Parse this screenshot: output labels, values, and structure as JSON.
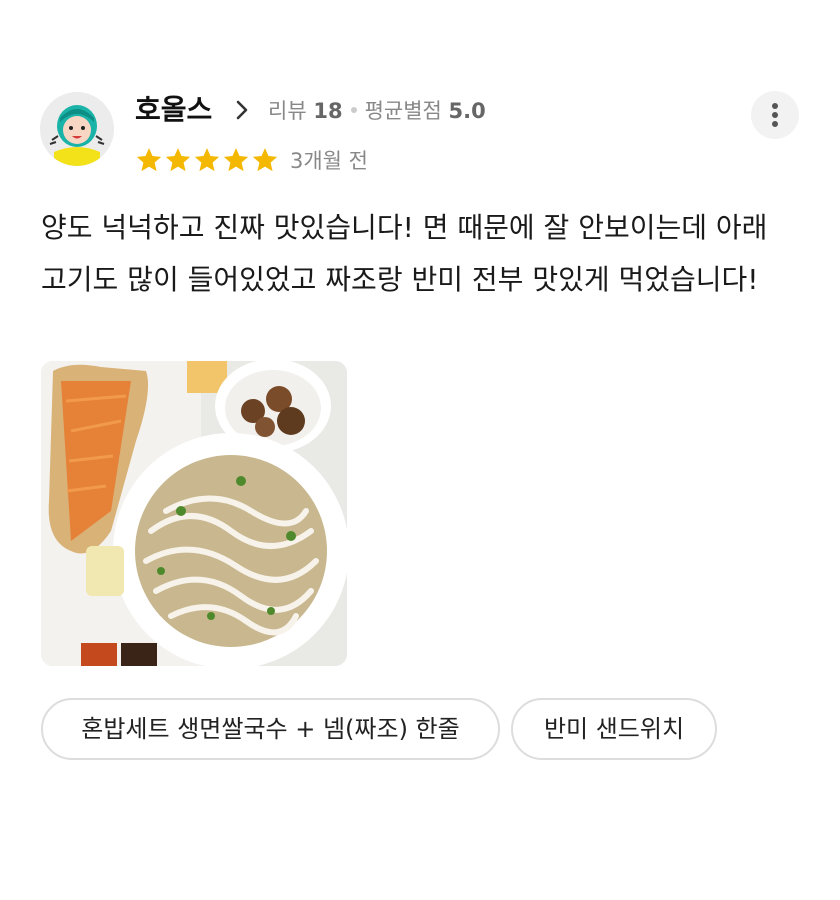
{
  "reviewer": {
    "nickname": "호올스",
    "review_count_label": "리뷰",
    "review_count": "18",
    "avg_rating_label": "평균별점",
    "avg_rating": "5.0",
    "avatar_icon": "cartoon-girl-avatar"
  },
  "rating": {
    "stars": 5,
    "max": 5,
    "star_color": "#F5B800"
  },
  "date": "3개월 전",
  "review_text": "양도 넉넉하고 진짜 맛있습니다! 면 때문에 잘 안보이는데 아래 고기도 많이 들어있었고 짜조랑 반미 전부 맛있게 먹었습니다!",
  "photo": {
    "icon": "food-photo"
  },
  "menu_tags": [
    "혼밥세트 생면쌀국수 + 넴(짜조) 한줄",
    "반미 샌드위치"
  ],
  "icons": {
    "chevron": "chevron-right-icon",
    "more": "more-vertical-icon"
  }
}
